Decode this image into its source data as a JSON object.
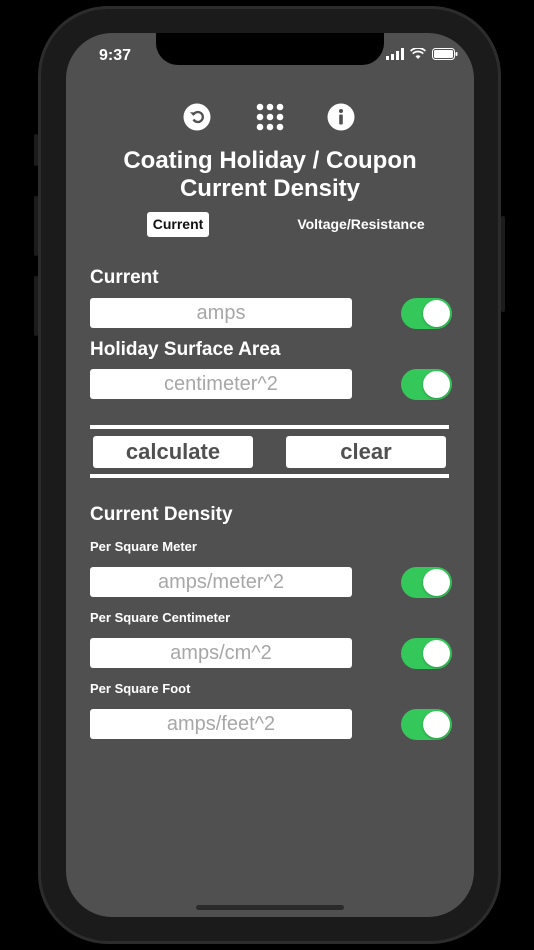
{
  "status_bar": {
    "time": "9:37"
  },
  "toolbar": {
    "icons": [
      "undo-icon",
      "keypad-icon",
      "info-icon"
    ]
  },
  "title": {
    "line1": "Coating Holiday / Coupon",
    "line2": "Current Density"
  },
  "segments": {
    "selected": "Current",
    "other": "Voltage/Resistance"
  },
  "inputs": {
    "current": {
      "label": "Current",
      "placeholder": "amps",
      "toggle_on": true
    },
    "area": {
      "label": "Holiday Surface Area",
      "placeholder": "centimeter^2",
      "toggle_on": true
    }
  },
  "actions": {
    "calculate": "calculate",
    "clear": "clear"
  },
  "results": {
    "heading": "Current Density",
    "per_m2": {
      "label": "Per Square Meter",
      "placeholder": "amps/meter^2",
      "toggle_on": true
    },
    "per_cm2": {
      "label": "Per Square Centimeter",
      "placeholder": "amps/cm^2",
      "toggle_on": true
    },
    "per_ft2": {
      "label": "Per Square Foot",
      "placeholder": "amps/feet^2",
      "toggle_on": true
    }
  },
  "colors": {
    "background": "#505050",
    "toggle_on": "#34c759",
    "text": "#ffffff",
    "placeholder": "#a7a7a7"
  }
}
